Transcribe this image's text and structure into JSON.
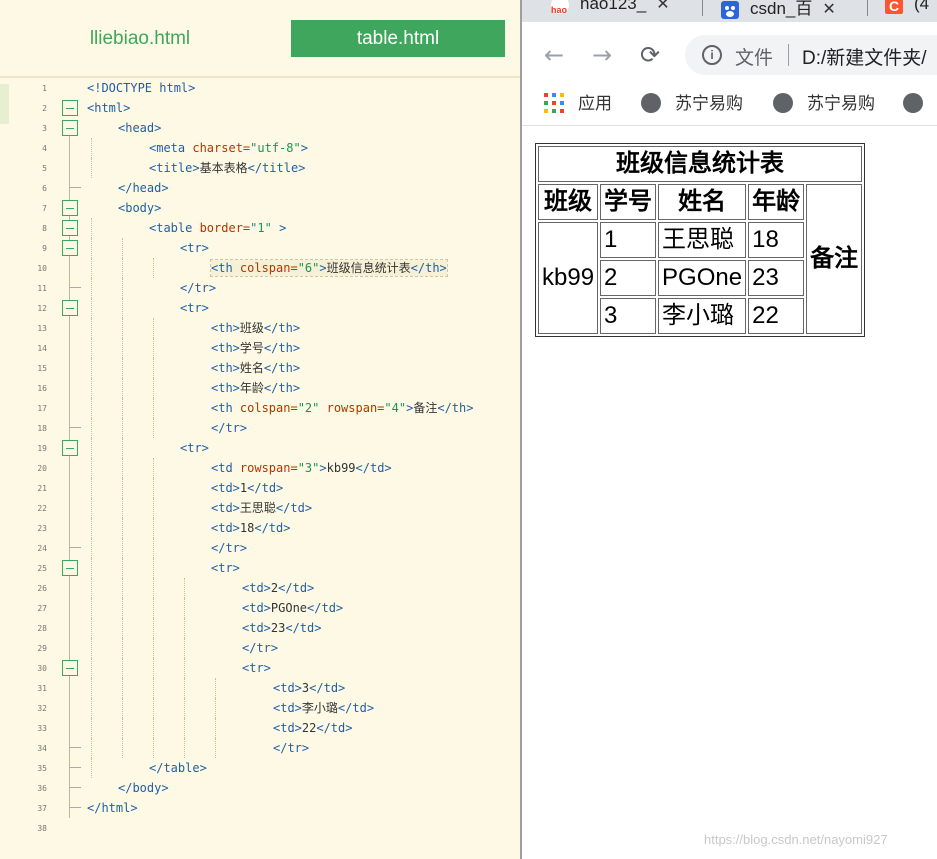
{
  "editor": {
    "tabs": [
      "lliebiao.html",
      "table.html"
    ],
    "active_tab": "table.html",
    "lines": [
      {
        "n": "1",
        "indent": 0,
        "fold": "",
        "parts": [
          [
            "tag",
            "<!DOCTYPE html>"
          ]
        ]
      },
      {
        "n": "2",
        "indent": 0,
        "fold": "open",
        "parts": [
          [
            "tag",
            "<html>"
          ]
        ]
      },
      {
        "n": "3",
        "indent": 1,
        "fold": "open",
        "parts": [
          [
            "tag",
            "<head>"
          ]
        ]
      },
      {
        "n": "4",
        "indent": 2,
        "fold": "",
        "parts": [
          [
            "tag",
            "<meta "
          ],
          [
            "attr",
            "charset="
          ],
          [
            "val",
            "\"utf-8\""
          ],
          [
            "tag",
            ">"
          ]
        ]
      },
      {
        "n": "5",
        "indent": 2,
        "fold": "",
        "parts": [
          [
            "tag",
            "<title>"
          ],
          [
            "text",
            "基本表格"
          ],
          [
            "tag",
            "</title>"
          ]
        ]
      },
      {
        "n": "6",
        "indent": 1,
        "fold": "end",
        "parts": [
          [
            "tag",
            "</head>"
          ]
        ]
      },
      {
        "n": "7",
        "indent": 1,
        "fold": "open",
        "parts": [
          [
            "tag",
            "<body>"
          ]
        ]
      },
      {
        "n": "8",
        "indent": 2,
        "fold": "open",
        "parts": [
          [
            "tag",
            "<table "
          ],
          [
            "attr",
            "border="
          ],
          [
            "val",
            "\"1\""
          ],
          [
            "tag",
            " >"
          ]
        ]
      },
      {
        "n": "9",
        "indent": 3,
        "fold": "open",
        "parts": [
          [
            "tag",
            "<tr>"
          ]
        ]
      },
      {
        "n": "10",
        "indent": 4,
        "fold": "",
        "selected": true,
        "parts": [
          [
            "tag",
            "<th "
          ],
          [
            "attr",
            "colspan="
          ],
          [
            "val",
            "\"6\""
          ],
          [
            "tag",
            ">"
          ],
          [
            "text",
            "班级信息统计表"
          ],
          [
            "tag",
            "</th>"
          ]
        ]
      },
      {
        "n": "11",
        "indent": 3,
        "fold": "end",
        "parts": [
          [
            "tag",
            "</tr>"
          ]
        ]
      },
      {
        "n": "12",
        "indent": 3,
        "fold": "open",
        "parts": [
          [
            "tag",
            "<tr>"
          ]
        ]
      },
      {
        "n": "13",
        "indent": 4,
        "fold": "",
        "parts": [
          [
            "tag",
            "<th>"
          ],
          [
            "text",
            "班级"
          ],
          [
            "tag",
            "</th>"
          ]
        ]
      },
      {
        "n": "14",
        "indent": 4,
        "fold": "",
        "parts": [
          [
            "tag",
            "<th>"
          ],
          [
            "text",
            "学号"
          ],
          [
            "tag",
            "</th>"
          ]
        ]
      },
      {
        "n": "15",
        "indent": 4,
        "fold": "",
        "parts": [
          [
            "tag",
            "<th>"
          ],
          [
            "text",
            "姓名"
          ],
          [
            "tag",
            "</th>"
          ]
        ]
      },
      {
        "n": "16",
        "indent": 4,
        "fold": "",
        "parts": [
          [
            "tag",
            "<th>"
          ],
          [
            "text",
            "年龄"
          ],
          [
            "tag",
            "</th>"
          ]
        ]
      },
      {
        "n": "17",
        "indent": 4,
        "fold": "",
        "parts": [
          [
            "tag",
            "<th "
          ],
          [
            "attr",
            "colspan="
          ],
          [
            "val",
            "\"2\" "
          ],
          [
            "attr",
            "rowspan="
          ],
          [
            "val",
            "\"4\""
          ],
          [
            "tag",
            ">"
          ],
          [
            "text",
            "备注"
          ],
          [
            "tag",
            "</th>"
          ]
        ]
      },
      {
        "n": "18",
        "indent": 4,
        "fold": "end",
        "parts": [
          [
            "tag",
            "</tr>"
          ]
        ]
      },
      {
        "n": "19",
        "indent": 3,
        "fold": "open",
        "parts": [
          [
            "tag",
            "<tr>"
          ]
        ]
      },
      {
        "n": "20",
        "indent": 4,
        "fold": "",
        "parts": [
          [
            "tag",
            "<td "
          ],
          [
            "attr",
            "rowspan="
          ],
          [
            "val",
            "\"3\""
          ],
          [
            "tag",
            ">"
          ],
          [
            "text",
            "kb99"
          ],
          [
            "tag",
            "</td>"
          ]
        ]
      },
      {
        "n": "21",
        "indent": 4,
        "fold": "",
        "parts": [
          [
            "tag",
            "<td>"
          ],
          [
            "text",
            "1"
          ],
          [
            "tag",
            "</td>"
          ]
        ]
      },
      {
        "n": "22",
        "indent": 4,
        "fold": "",
        "parts": [
          [
            "tag",
            "<td>"
          ],
          [
            "text",
            "王思聪"
          ],
          [
            "tag",
            "</td>"
          ]
        ]
      },
      {
        "n": "23",
        "indent": 4,
        "fold": "",
        "parts": [
          [
            "tag",
            "<td>"
          ],
          [
            "text",
            "18"
          ],
          [
            "tag",
            "</td>"
          ]
        ]
      },
      {
        "n": "24",
        "indent": 4,
        "fold": "end",
        "parts": [
          [
            "tag",
            "</tr>"
          ]
        ]
      },
      {
        "n": "25",
        "indent": 4,
        "fold": "open",
        "parts": [
          [
            "tag",
            "<tr>"
          ]
        ]
      },
      {
        "n": "26",
        "indent": 5,
        "fold": "",
        "parts": [
          [
            "tag",
            "<td>"
          ],
          [
            "text",
            "2"
          ],
          [
            "tag",
            "</td>"
          ]
        ]
      },
      {
        "n": "27",
        "indent": 5,
        "fold": "",
        "parts": [
          [
            "tag",
            "<td>"
          ],
          [
            "text",
            "PGOne"
          ],
          [
            "tag",
            "</td>"
          ]
        ]
      },
      {
        "n": "28",
        "indent": 5,
        "fold": "",
        "parts": [
          [
            "tag",
            "<td>"
          ],
          [
            "text",
            "23"
          ],
          [
            "tag",
            "</td>"
          ]
        ]
      },
      {
        "n": "29",
        "indent": 5,
        "fold": "",
        "parts": [
          [
            "tag",
            "</tr>"
          ]
        ]
      },
      {
        "n": "30",
        "indent": 5,
        "fold": "open",
        "parts": [
          [
            "tag",
            "<tr>"
          ]
        ]
      },
      {
        "n": "31",
        "indent": 6,
        "fold": "",
        "parts": [
          [
            "tag",
            "<td>"
          ],
          [
            "text",
            "3"
          ],
          [
            "tag",
            "</td>"
          ]
        ]
      },
      {
        "n": "32",
        "indent": 6,
        "fold": "",
        "parts": [
          [
            "tag",
            "<td>"
          ],
          [
            "text",
            "李小璐"
          ],
          [
            "tag",
            "</td>"
          ]
        ]
      },
      {
        "n": "33",
        "indent": 6,
        "fold": "",
        "parts": [
          [
            "tag",
            "<td>"
          ],
          [
            "text",
            "22"
          ],
          [
            "tag",
            "</td>"
          ]
        ]
      },
      {
        "n": "34",
        "indent": 6,
        "fold": "end",
        "parts": [
          [
            "tag",
            "</tr>"
          ]
        ]
      },
      {
        "n": "35",
        "indent": 2,
        "fold": "end",
        "parts": [
          [
            "tag",
            "</table>"
          ]
        ]
      },
      {
        "n": "36",
        "indent": 1,
        "fold": "end",
        "parts": [
          [
            "tag",
            "</body>"
          ]
        ]
      },
      {
        "n": "37",
        "indent": 0,
        "fold": "end",
        "parts": [
          [
            "tag",
            "</html>"
          ]
        ]
      },
      {
        "n": "38",
        "indent": 0,
        "fold": "",
        "parts": []
      }
    ]
  },
  "browser": {
    "tabs": [
      {
        "label": "hao123_",
        "icon": "hao123-icon",
        "close": "✕"
      },
      {
        "label": "csdn_百",
        "icon": "baidu-paw-icon",
        "close": "✕"
      },
      {
        "label": "(4",
        "icon": "csdn-c-icon",
        "close": ""
      }
    ],
    "nav": {
      "back": "←",
      "forward": "→",
      "reload": "⟳"
    },
    "address": {
      "info": "i",
      "scheme": "文件",
      "url": "D:/新建文件夹/"
    },
    "bookmarks": {
      "apps": "应用",
      "items": [
        "苏宁易购",
        "苏宁易购",
        ""
      ]
    },
    "page_table": {
      "caption": "班级信息统计表",
      "headers": [
        "班级",
        "学号",
        "姓名",
        "年龄"
      ],
      "remark": "备注",
      "class_name": "kb99",
      "rows": [
        [
          "1",
          "王思聪",
          "18"
        ],
        [
          "2",
          "PGOne",
          "23"
        ],
        [
          "3",
          "李小璐",
          "22"
        ]
      ]
    },
    "watermark": "https://blog.csdn.net/nayomi927"
  },
  "colors": {
    "editor_bg": "#fdf9e4",
    "accent_green": "#3fa75d",
    "tag_blue": "#1f5fa8",
    "attr_red": "#b53500",
    "value_green": "#18935b"
  }
}
